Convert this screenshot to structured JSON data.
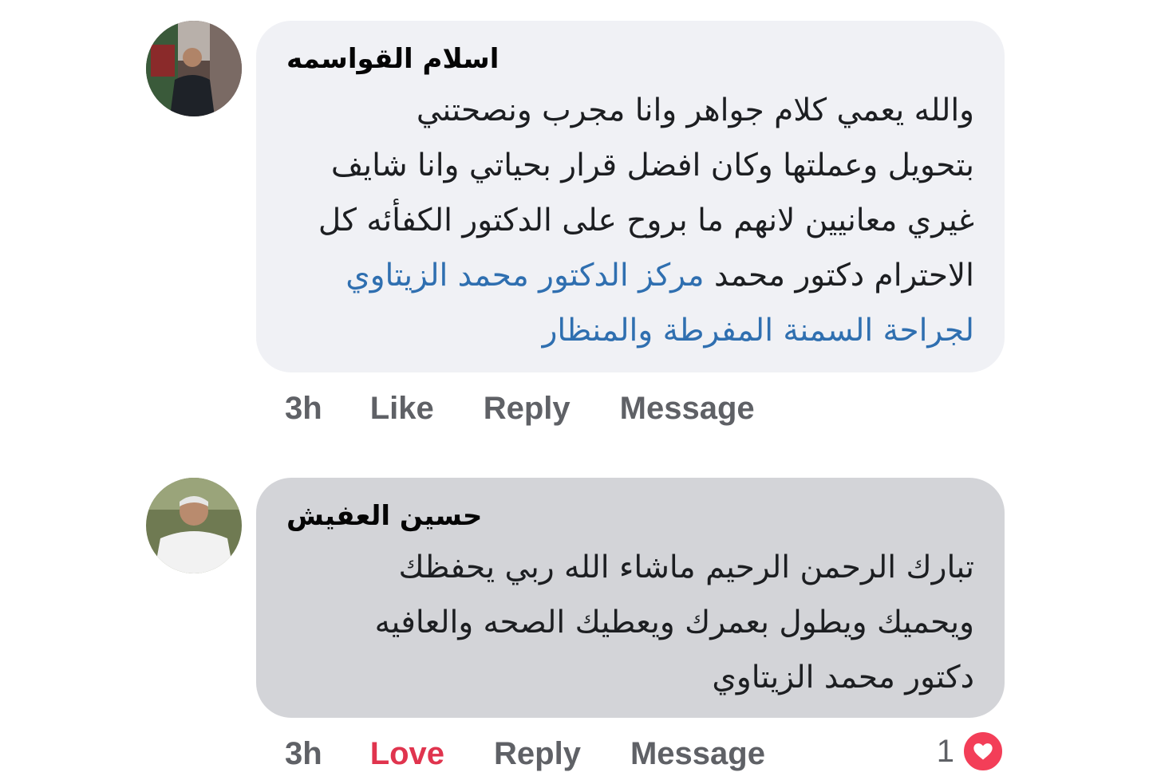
{
  "comments": [
    {
      "author": "اسلام القواسمه",
      "lines": [
        "والله يعمي كلام جواهر وانا مجرب ونصحتني",
        "بتحويل وعملتها وكان افضل قرار بحياتي وانا شايف",
        "غيري معانيين لانهم ما بروح على الدكتور الكفأئه كل",
        "الاحترام دكتور محمد"
      ],
      "mention_line4": "مركز الدكتور محمد الزيتاوي",
      "mention_line5": "لجراحة السمنة المفرطة والمنظار",
      "time": "3h",
      "like_label": "Like",
      "reply_label": "Reply",
      "message_label": "Message"
    },
    {
      "author": "حسين العفيش",
      "lines": [
        "تبارك الرحمن الرحيم ماشاء الله ربي يحفظك",
        "ويحميك ويطول بعمرك ويعطيك الصحه والعافيه",
        "دكتور محمد الزيتاوي"
      ],
      "time": "3h",
      "like_label": "Love",
      "reply_label": "Reply",
      "message_label": "Message",
      "reaction_count": "1",
      "reaction_icon": "heart-icon"
    }
  ],
  "colors": {
    "bubble_1": "#f0f1f5",
    "bubble_2": "#d3d4d8",
    "mention": "#2f6fb0",
    "love": "#e0344e",
    "action_text": "#5f6166",
    "heart_badge": "#f33e58"
  }
}
